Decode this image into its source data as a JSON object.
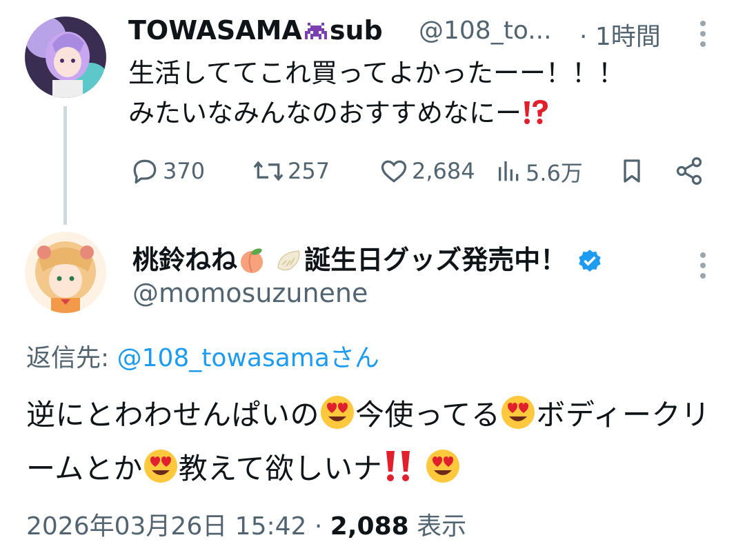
{
  "tweet1": {
    "display_name": "TOWASAMA",
    "display_name_suffix": "sub",
    "handle": "@108_to...",
    "separator": "·",
    "time": "1時間",
    "text_line1": "生活しててこれ買ってよかったーー！！！",
    "text_line2": "みたいなみんなのおすすめなにー",
    "actions": {
      "replies": "370",
      "retweets": "257",
      "likes": "2,684",
      "views": "5.6万"
    }
  },
  "tweet2": {
    "display_name": "桃鈴ねね",
    "display_name_suffix": "誕生日グッズ発売中！",
    "handle": "@momosuzunene",
    "reply_prefix": "返信先:",
    "reply_target": "@108_towasamaさん",
    "text_part1": "逆にとわわせんぱいの",
    "text_part2": "今使ってる",
    "text_part3": "ボディークリームとか",
    "text_part4": "教えて欲しいナ",
    "date": "2026年03月26日 15:42",
    "meta_sep": "·",
    "view_count": "2,088",
    "view_label": "表示"
  },
  "colors": {
    "accent": "#1d9bf0",
    "secondary_text": "#536471",
    "thread_line": "#cfd9de",
    "exclaim_red": "#e0202d"
  }
}
